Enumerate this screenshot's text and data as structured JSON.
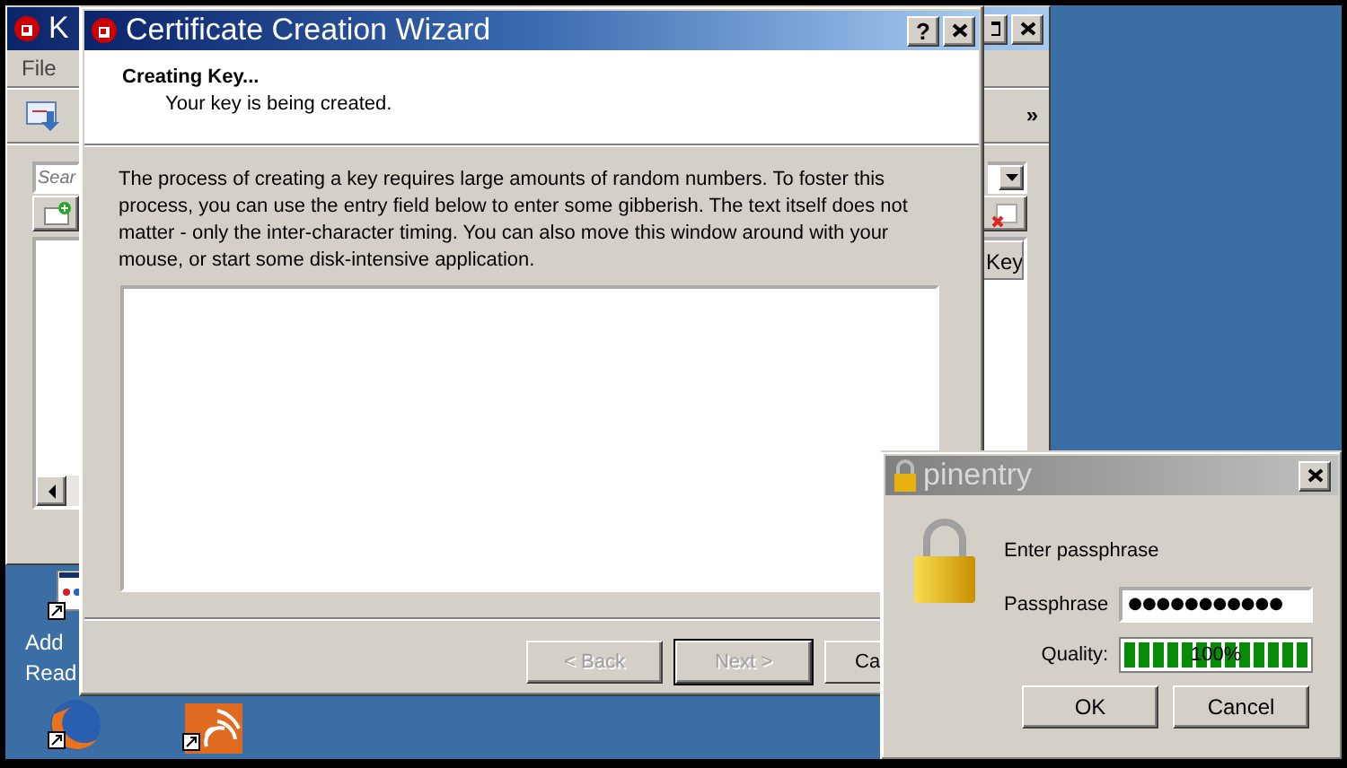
{
  "background_window": {
    "title": "K",
    "menu": [
      {
        "label": "File"
      }
    ],
    "toolbar_overflow": "»",
    "search": {
      "placeholder": "Sear"
    },
    "table": {
      "columns": [
        "Key"
      ]
    }
  },
  "wizard": {
    "title": "Certificate Creation Wizard",
    "help": "?",
    "heading": "Creating Key...",
    "subheading": "Your key is being created.",
    "description": "The process of creating a key requires large amounts of random numbers. To foster this process, you can use the entry field below to enter some gibberish. The text itself does not matter - only the inter-character timing. You can also move this window around with your mouse, or start some disk-intensive application.",
    "buttons": [
      {
        "label": "< Back",
        "disabled": true,
        "default": false
      },
      {
        "label": "Next >",
        "disabled": true,
        "default": true
      },
      {
        "label": "Ca",
        "disabled": false,
        "default": false
      }
    ]
  },
  "pinentry": {
    "title": "pinentry",
    "prompt": "Enter passphrase",
    "passphrase": {
      "label": "Passphrase",
      "value": "●●●●●●●●●●●"
    },
    "quality": {
      "label": "Quality:",
      "level": 1,
      "reading": "100%"
    },
    "buttons": [
      {
        "label": "OK"
      },
      {
        "label": "Cancel"
      }
    ]
  },
  "desktop": {
    "icons": [
      {
        "kind": "document",
        "label": [
          "Add",
          "Read"
        ]
      },
      {
        "kind": "browser"
      },
      {
        "kind": "feed"
      }
    ]
  }
}
